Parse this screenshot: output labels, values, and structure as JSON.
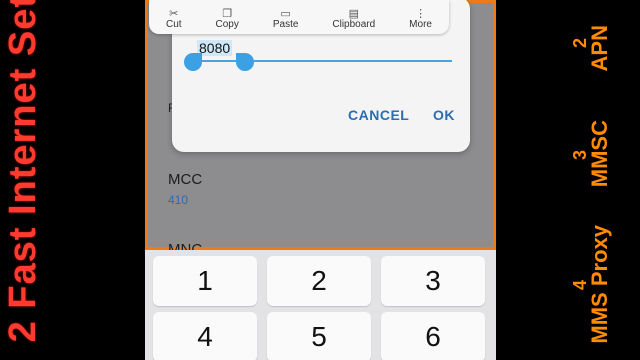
{
  "overlay": {
    "left_title": "2 Fast Internet Set",
    "right_labels": [
      {
        "label": "APN",
        "num": "2"
      },
      {
        "label": "MMSC",
        "num": "3"
      },
      {
        "label": "MMS Proxy",
        "num": "4"
      }
    ]
  },
  "toolbar": {
    "items": [
      {
        "label": "Cut",
        "icon": "scissors-icon"
      },
      {
        "label": "Copy",
        "icon": "copy-icon"
      },
      {
        "label": "Paste",
        "icon": "paste-icon"
      },
      {
        "label": "Clipboard",
        "icon": "clipboard-icon"
      },
      {
        "label": "More",
        "icon": "more-icon"
      }
    ]
  },
  "dialog": {
    "input_value": "8080",
    "cancel_label": "CANCEL",
    "ok_label": "OK"
  },
  "settings": {
    "partial_label": "F",
    "mcc_label": "MCC",
    "mcc_value": "410",
    "mnc_label": "MNC"
  },
  "keypad": {
    "keys": [
      "1",
      "2",
      "3",
      "4",
      "5",
      "6"
    ]
  },
  "colors": {
    "accent": "#2b6db3",
    "handle": "#3ba0e4",
    "frame": "#f07a15",
    "overlay_left": "#ff3b2f",
    "overlay_right": "#ff8c00"
  }
}
